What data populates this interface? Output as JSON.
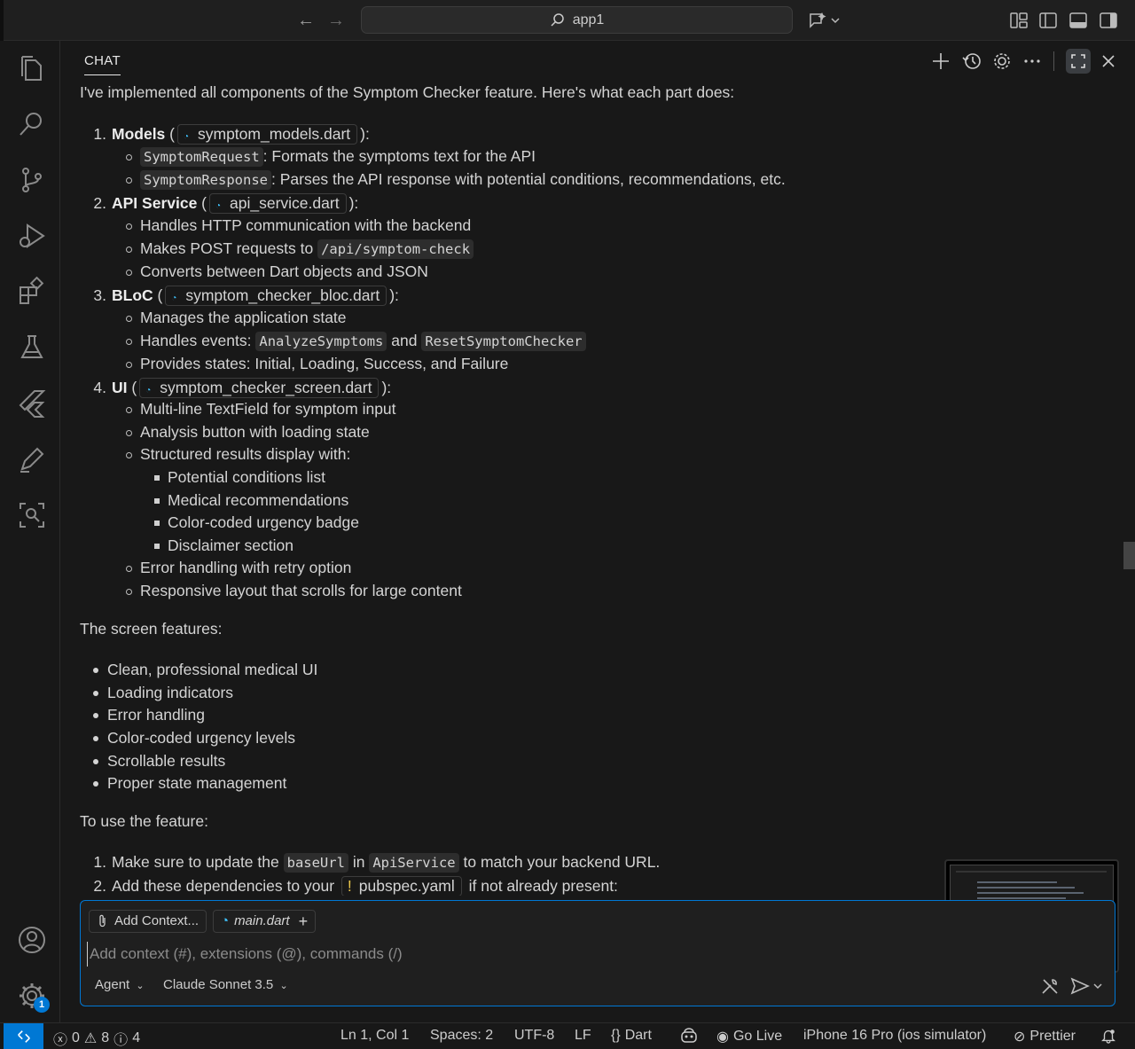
{
  "titlebar": {
    "search_text": "app1"
  },
  "chat": {
    "tab_label": "CHAT",
    "intro": "I've implemented all components of the Symptom Checker feature. Here's what each part does:",
    "sections": [
      {
        "num": "1.",
        "title": "Models",
        "file": "symptom_models.dart"
      },
      {
        "num": "2.",
        "title": "API Service",
        "file": "api_service.dart"
      },
      {
        "num": "3.",
        "title": "BLoC",
        "file": "symptom_checker_bloc.dart"
      },
      {
        "num": "4.",
        "title": "UI",
        "file": "symptom_checker_screen.dart"
      }
    ],
    "models_items": [
      {
        "code": "SymptomRequest",
        "text": ": Formats the symptoms text for the API"
      },
      {
        "code": "SymptomResponse",
        "text": ": Parses the API response with potential conditions, recommendations, etc."
      }
    ],
    "api_items": [
      "Handles HTTP communication with the backend",
      "Makes POST requests to",
      "/api/symptom-check",
      "Converts between Dart objects and JSON"
    ],
    "bloc_items": [
      "Manages the application state",
      "Handles events:",
      "AnalyzeSymptoms",
      "and",
      "ResetSymptomChecker",
      "Provides states: Initial, Loading, Success, and Failure"
    ],
    "ui_items": [
      "Multi-line TextField for symptom input",
      "Analysis button with loading state",
      "Structured results display with:",
      "Potential conditions list",
      "Medical recommendations",
      "Color-coded urgency badge",
      "Disclaimer section",
      "Error handling with retry option",
      "Responsive layout that scrolls for large content"
    ],
    "screen_features_heading": "The screen features:",
    "screen_features": [
      "Clean, professional medical UI",
      "Loading indicators",
      "Error handling",
      "Color-coded urgency levels",
      "Scrollable results",
      "Proper state management"
    ],
    "use_heading": "To use the feature:",
    "use_steps": {
      "s1_num": "1.",
      "s1_a": "Make sure to update the",
      "s1_code1": "baseUrl",
      "s1_b": "in",
      "s1_code2": "ApiService",
      "s1_c": "to match your backend URL.",
      "s2_num": "2.",
      "s2_a": "Add these dependencies to your",
      "s2_file": "pubspec.yaml",
      "s2_b": "if not already present:"
    }
  },
  "input": {
    "add_context_label": "Add Context...",
    "file_chip_label": "main.dart",
    "placeholder": "Add context (#), extensions (@), commands (/)",
    "mode_label": "Agent",
    "model_label": "Claude Sonnet 3.5"
  },
  "activitybar": {
    "settings_badge": "1"
  },
  "statusbar": {
    "errors": "0",
    "warnings": "8",
    "info": "4",
    "position": "Ln 1, Col 1",
    "spaces": "Spaces: 2",
    "encoding": "UTF-8",
    "eol": "LF",
    "language": "Dart",
    "go_live": "Go Live",
    "device": "iPhone 16 Pro (ios simulator)",
    "prettier": "Prettier"
  }
}
